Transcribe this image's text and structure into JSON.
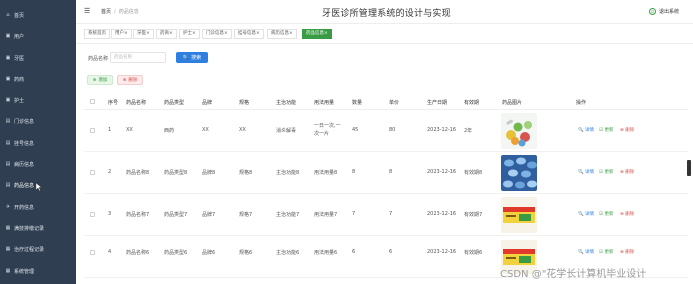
{
  "header": {
    "system_title": "牙医诊所管理系统的设计与实现",
    "breadcrumb_home": "首页",
    "breadcrumb_sep": "/",
    "breadcrumb_current": "药品信息",
    "logout_label": "退出系统"
  },
  "sidebar": {
    "items": [
      {
        "label": "首页",
        "icon": "home-icon"
      },
      {
        "label": "用户",
        "icon": "user-icon"
      },
      {
        "label": "牙医",
        "icon": "dentist-icon"
      },
      {
        "label": "药商",
        "icon": "supplier-icon"
      },
      {
        "label": "护士",
        "icon": "nurse-icon"
      },
      {
        "label": "门诊信息",
        "icon": "clinic-icon"
      },
      {
        "label": "挂号信息",
        "icon": "register-icon"
      },
      {
        "label": "病历信息",
        "icon": "record-icon"
      },
      {
        "label": "药品信息",
        "icon": "medicine-icon"
      },
      {
        "label": "开药信息",
        "icon": "prescribe-icon"
      },
      {
        "label": "满技排缴记录",
        "icon": "payment-icon"
      },
      {
        "label": "治疗过程记录",
        "icon": "treatment-icon"
      },
      {
        "label": "系统管理",
        "icon": "settings-icon"
      }
    ]
  },
  "tabs": [
    "系统首页",
    "用户×",
    "牙医×",
    "药商×",
    "护士×",
    "门诊信息×",
    "挂号信息×",
    "病历信息×",
    "药品信息×"
  ],
  "search": {
    "label": "药品名称",
    "placeholder": "药品名称",
    "button": "搜索"
  },
  "actions": {
    "add": "增加",
    "delete": "删除"
  },
  "table": {
    "columns": [
      "序号",
      "药品名称",
      "药品类型",
      "品牌",
      "规格",
      "主治功能",
      "用法用量",
      "数量",
      "单价",
      "生产日期",
      "有效期",
      "药品图片",
      "操作"
    ],
    "rows": [
      {
        "no": "1",
        "name": "XX",
        "type": "西药",
        "brand": "XX",
        "spec": "XX",
        "func": "消炎解毒",
        "usage": "一日一次,一次一片",
        "qty": "45",
        "price": "80",
        "date": "2023-12-16",
        "valid": "2年"
      },
      {
        "no": "2",
        "name": "药品名称8",
        "type": "药品类型8",
        "brand": "品牌8",
        "spec": "规格8",
        "func": "主治功能8",
        "usage": "用法用量8",
        "qty": "8",
        "price": "8",
        "date": "2023-12-16",
        "valid": "有效期8"
      },
      {
        "no": "3",
        "name": "药品名称7",
        "type": "药品类型7",
        "brand": "品牌7",
        "spec": "规格7",
        "func": "主治功能7",
        "usage": "用法用量7",
        "qty": "7",
        "price": "7",
        "date": "2023-12-16",
        "valid": "有效期7"
      },
      {
        "no": "4",
        "name": "药品名称6",
        "type": "药品类型6",
        "brand": "品牌6",
        "spec": "规格6",
        "func": "主治功能6",
        "usage": "用法用量6",
        "qty": "6",
        "price": "6",
        "date": "2023-12-16",
        "valid": "有效期6"
      }
    ],
    "ops": {
      "detail": "详情",
      "edit": "更新",
      "delete": "删除"
    }
  },
  "watermark": "CSDN @\"花学长计算机毕业设计",
  "colors": {
    "sidebar": "#2f3e50",
    "accent_green": "#3a9b45",
    "primary_blue": "#2f7fe0",
    "danger_red": "#d9534f"
  }
}
